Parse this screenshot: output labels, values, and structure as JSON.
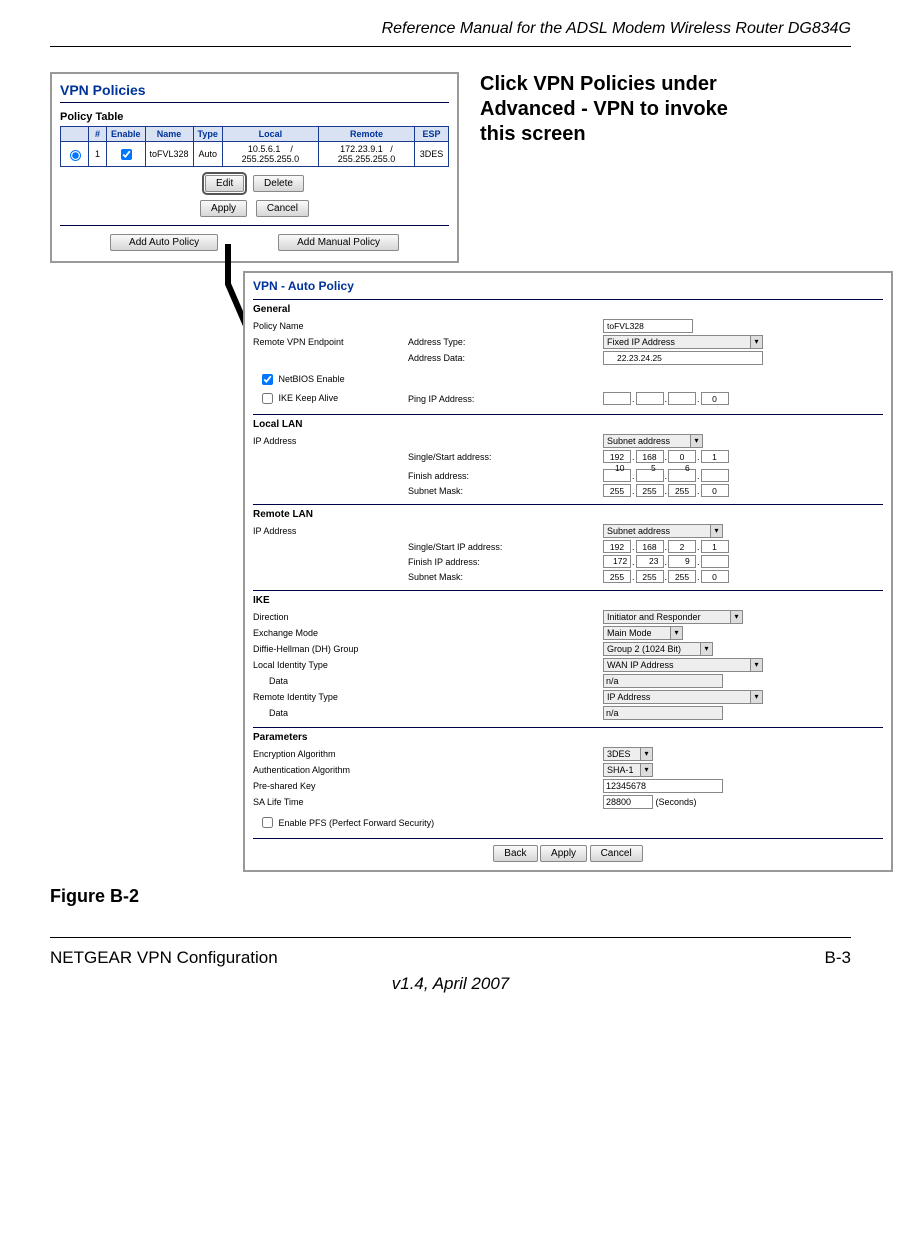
{
  "doc": {
    "header": "Reference Manual for the ADSL Modem Wireless Router DG834G",
    "footer_left": "NETGEAR VPN Configuration",
    "footer_right": "B-3",
    "version": "v1.4, April 2007",
    "figure_label": "Figure B-2"
  },
  "callout": {
    "l1": "Click VPN Policies under",
    "l2": "Advanced - VPN to invoke",
    "l3": "this screen"
  },
  "policies": {
    "title": "VPN Policies",
    "table_label": "Policy Table",
    "headers": {
      "sel": "",
      "idx": "#",
      "enable": "Enable",
      "name": "Name",
      "type": "Type",
      "local": "Local",
      "remote": "Remote",
      "esp": "ESP"
    },
    "row": {
      "idx": "1",
      "enable_checked": true,
      "name": "toFVL328",
      "type": "Auto",
      "local1": "10.5.6.1",
      "local2": "/",
      "local3": "255.255.255.0",
      "remote1": "172.23.9.1",
      "remote2": "/",
      "remote3": "255.255.255.0",
      "esp": "3DES"
    },
    "buttons": {
      "edit": "Edit",
      "delete": "Delete",
      "apply": "Apply",
      "cancel": "Cancel",
      "add_auto": "Add Auto Policy",
      "add_manual": "Add Manual Policy"
    }
  },
  "auto": {
    "title": "VPN - Auto Policy",
    "sections": {
      "general": "General",
      "local": "Local LAN",
      "remote": "Remote LAN",
      "ike": "IKE",
      "params": "Parameters"
    },
    "general": {
      "policy_name_label": "Policy Name",
      "policy_name_value": "toFVL328",
      "remote_endpoint_label": "Remote VPN Endpoint",
      "address_type_label": "Address Type:",
      "address_type_value": "Fixed IP Address",
      "address_data_label": "Address Data:",
      "address_data_value": "22.23.24.25",
      "netbios_label": "NetBIOS Enable",
      "ike_keepalive_label": "IKE Keep Alive",
      "ping_label": "Ping IP Address:",
      "ping_last": "0"
    },
    "local_lan": {
      "ip_label": "IP Address",
      "ip_mode": "Subnet address",
      "single_label": "Single/Start address:",
      "single": [
        "192",
        "168",
        "0",
        "1"
      ],
      "single_annot": [
        "10",
        "5",
        "6"
      ],
      "finish_label": "Finish address:",
      "mask_label": "Subnet Mask:",
      "mask": [
        "255",
        "255",
        "255",
        "0"
      ]
    },
    "remote_lan": {
      "ip_label": "IP Address",
      "ip_mode": "Subnet address",
      "single_label": "Single/Start IP address:",
      "single": [
        "192",
        "168",
        "2",
        "1"
      ],
      "finish_label": "Finish IP address:",
      "finish_annot": [
        "172",
        "23",
        "9"
      ],
      "mask_label": "Subnet Mask:",
      "mask": [
        "255",
        "255",
        "255",
        "0"
      ]
    },
    "ike": {
      "direction_label": "Direction",
      "direction_value": "Initiator and Responder",
      "exchange_label": "Exchange Mode",
      "exchange_value": "Main Mode",
      "dh_label": "Diffie-Hellman (DH) Group",
      "dh_value": "Group 2 (1024 Bit)",
      "local_id_type_label": "Local Identity Type",
      "local_id_type_value": "WAN IP Address",
      "data_label": "Data",
      "data_value": "n/a",
      "remote_id_type_label": "Remote Identity Type",
      "remote_id_type_value": "IP Address"
    },
    "params": {
      "enc_label": "Encryption Algorithm",
      "enc_value": "3DES",
      "auth_label": "Authentication Algorithm",
      "auth_value": "SHA-1",
      "psk_label": "Pre-shared Key",
      "psk_value": "12345678",
      "sa_label": "SA Life Time",
      "sa_value": "28800",
      "sa_unit": "(Seconds)",
      "pfs_label": "Enable PFS (Perfect Forward Security)"
    },
    "buttons": {
      "back": "Back",
      "apply": "Apply",
      "cancel": "Cancel"
    }
  }
}
